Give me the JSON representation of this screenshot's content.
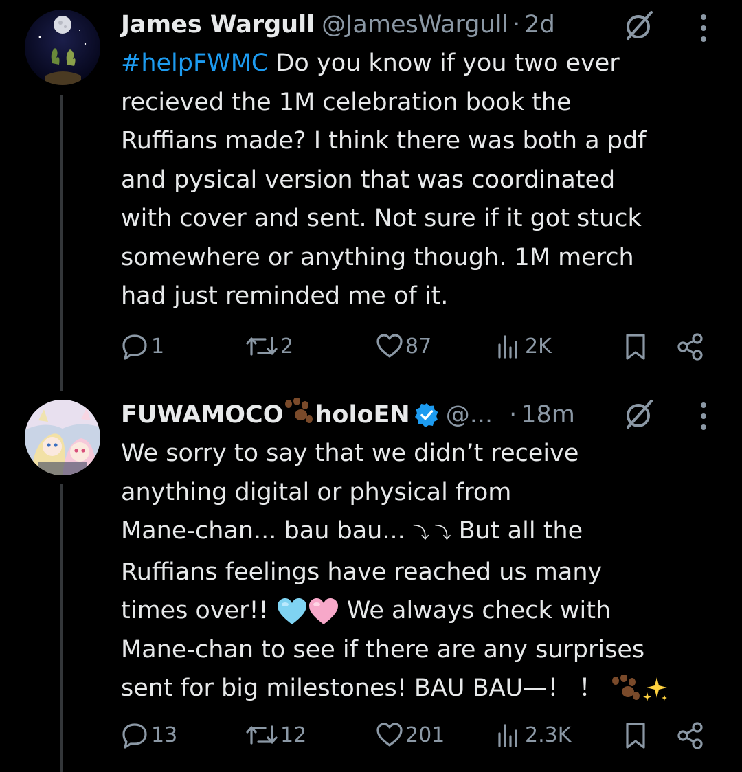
{
  "tweets": [
    {
      "author": "James Wargull",
      "handle": "@JamesWargull",
      "separator": "·",
      "time": "2d",
      "hashtag": "#helpFWMC",
      "text": " Do you know if you two ever\nrecieved the 1M celebration book the\nRuffians made? I think there was both a pdf\nand pysical version that was  coordinated\nwith cover and sent. Not sure if it got stuck\nsomewhere or anything though. 1M merch\nhad just reminded me of it.",
      "replies": "1",
      "reposts": "2",
      "likes": "87",
      "views": "2K"
    },
    {
      "author": "FUWAMOCO",
      "author_suffix": "holoEN",
      "handle": "@...",
      "separator": "·",
      "time": "18m",
      "text_1": "We sorry to say that we didn’t receive\nanything digital or physical from\nMane-chan... bau bau... ",
      "arrows": "⤵︎ ⤵︎",
      "text_2": " But all the\nRuffians feelings have reached us many\ntimes over!! ",
      "text_3": " We always check with\nMane-chan to see if there are any surprises\nsent for big milestones! BAU BAU—！ ！ ",
      "replies": "13",
      "reposts": "12",
      "likes": "201",
      "views": "2.3K"
    }
  ],
  "colors": {
    "background": "#000000",
    "text": "#e7e9ea",
    "secondary": "#8b98a5",
    "link": "#1d9bf0",
    "verified": "#1d9bf0"
  },
  "icons": [
    "grok-icon",
    "more-icon",
    "reply-icon",
    "repost-icon",
    "like-icon",
    "views-icon",
    "bookmark-icon",
    "share-icon",
    "verified-badge-icon",
    "paw-emoji",
    "sparkles-emoji",
    "light-blue-heart-emoji",
    "pink-heart-emoji"
  ]
}
